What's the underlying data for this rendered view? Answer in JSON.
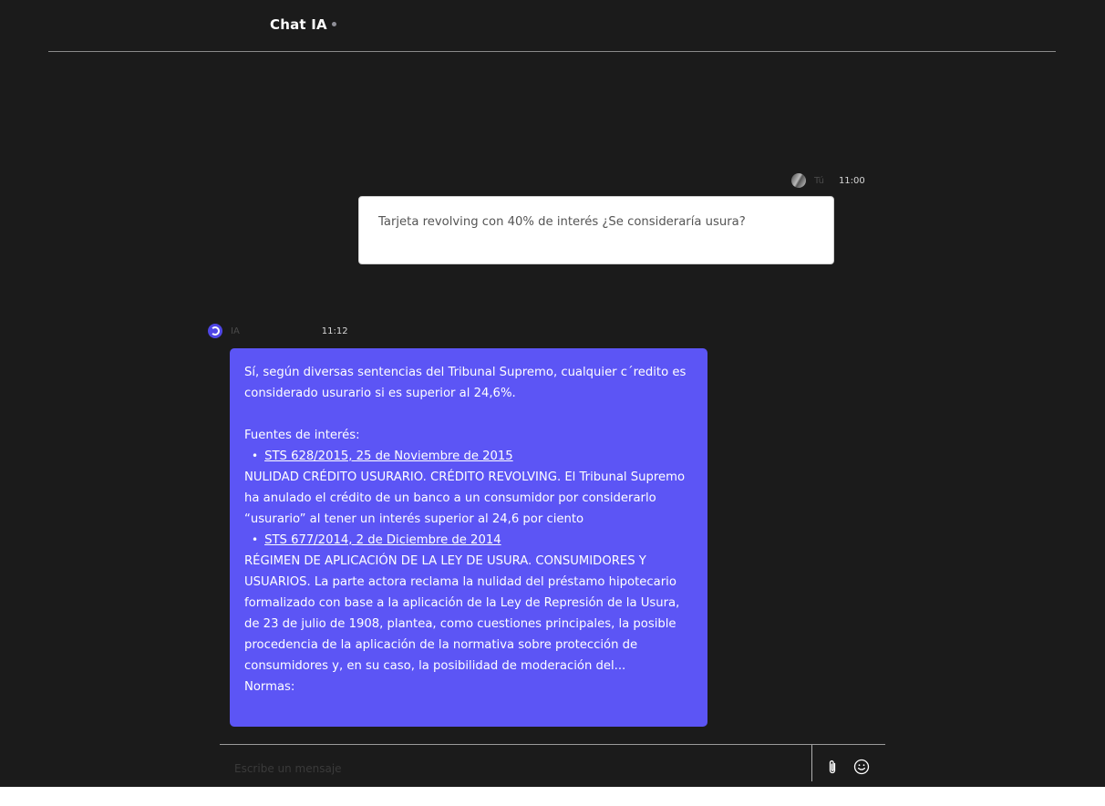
{
  "header": {
    "title": "Chat IA"
  },
  "messages": [
    {
      "sender": "Tú",
      "time": "11:00",
      "text": "Tarjeta revolving con 40% de interés ¿Se consideraría usura?"
    },
    {
      "sender": "IA",
      "time": "11:12",
      "intro": "Sí, según diversas sentencias del Tribunal Supremo, cualquier c´redito es considerado usurario si es superior al 24,6%.",
      "sources_heading": "Fuentes de interés:",
      "sources": [
        {
          "title": "STS 628/2015, 25 de Noviembre de 2015",
          "summary": "NULIDAD CRÉDITO USURARIO. CRÉDITO REVOLVING. El Tribunal Supremo ha anulado el crédito de un banco a un consumidor por considerarlo “usurario” al tener un interés superior al 24,6 por ciento"
        },
        {
          "title": "STS 677/2014, 2 de Diciembre de 2014",
          "summary": "RÉGIMEN DE APLICACIÓN DE LA LEY DE USURA. CONSUMIDORES Y USUARIOS. La parte actora reclama la nulidad del préstamo hipotecario formalizado con base a la aplicación de la Ley de Represión de la Usura, de 23 de julio de 1908, plantea, como cuestiones principales, la posible procedencia de la aplicación de la normativa sobre protección de consumidores y, en su caso, la posibilidad de moderación del..."
        }
      ],
      "norms_heading": "Normas:"
    }
  ],
  "composer": {
    "placeholder": "Escribe un mensaje",
    "value": ""
  },
  "icons": {
    "attach": "paperclip-icon",
    "emoji": "smiley-icon",
    "status": "status-dot-icon"
  },
  "colors": {
    "background": "#1b1b1b",
    "ai_bubble": "#5c55f5",
    "user_bubble": "#ffffff"
  }
}
